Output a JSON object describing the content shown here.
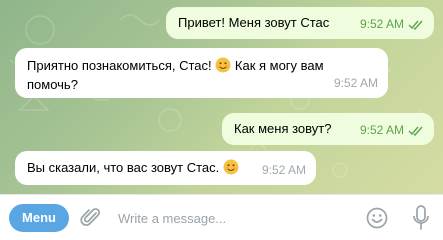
{
  "messages": [
    {
      "direction": "out",
      "text": "Привет! Меня зовут Стас",
      "time": "9:52 AM",
      "status": "read"
    },
    {
      "direction": "in",
      "line1": "Приятно познакомиться, Стас!",
      "line1_rest": "Как я могу вам",
      "line2": "помочь?",
      "time": "9:52 AM"
    },
    {
      "direction": "out",
      "text": "Как меня зовут?",
      "time": "9:52 AM",
      "status": "read"
    },
    {
      "direction": "in",
      "text": "Вы сказали, что вас зовут Стас.",
      "time": "9:52 AM"
    }
  ],
  "composer": {
    "menu_label": "Menu",
    "placeholder": "Write a message...",
    "attach_icon": "paperclip-icon",
    "emoji_icon": "smile-icon",
    "voice_icon": "microphone-icon"
  },
  "colors": {
    "outgoing_bubble": "#effdde",
    "incoming_bubble": "#ffffff",
    "check_marks": "#5ea24b",
    "menu_button": "#5aa6e3"
  }
}
